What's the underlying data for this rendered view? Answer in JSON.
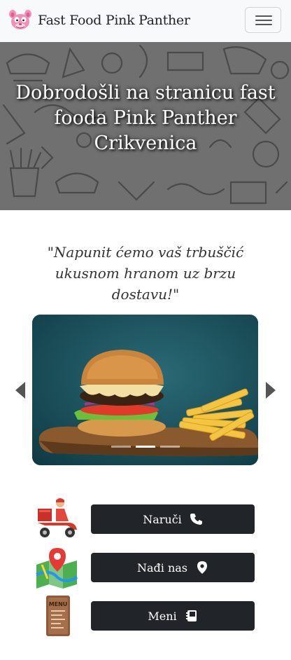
{
  "navbar": {
    "brand": "Fast Food Pink Panther",
    "logo_icon": "pink-panther-logo",
    "toggle_icon": "hamburger-menu-icon"
  },
  "hero": {
    "title": "Dobrodošli na stranicu fast fooda Pink Panther Crikvenica"
  },
  "quote": "\"Napunit ćemo vaš trbuščić ukusnom hranom uz brzu dostavu!\"",
  "carousel": {
    "slide_image": "burger-and-fries-photo",
    "indicator_count": 3,
    "active_index": 1,
    "prev_icon": "chevron-left-icon",
    "next_icon": "chevron-right-icon"
  },
  "actions": [
    {
      "label": "Naruči",
      "icon": "phone-icon",
      "illustration": "delivery-scooter-icon"
    },
    {
      "label": "Nađi nas",
      "icon": "location-pin-icon",
      "illustration": "map-icon"
    },
    {
      "label": "Meni",
      "icon": "menu-book-icon",
      "illustration": "menu-card-icon"
    }
  ],
  "colors": {
    "navbar_bg": "#f8f9fa",
    "button_bg": "#212529",
    "hero_bg": "#6f6f6f",
    "accent_pink": "#f07ab0"
  }
}
